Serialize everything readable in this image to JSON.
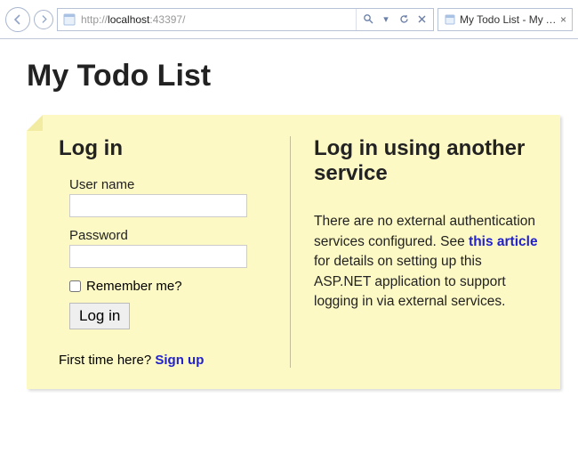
{
  "browser": {
    "url_scheme": "http://",
    "url_host": "localhost",
    "url_port": ":43397/",
    "tab_title": "My Todo List - My A..."
  },
  "page": {
    "title": "My Todo List"
  },
  "login": {
    "heading": "Log in",
    "username_label": "User name",
    "username_value": "",
    "password_label": "Password",
    "password_value": "",
    "remember_label": "Remember me?",
    "submit_label": "Log in",
    "signup_prefix": "First time here? ",
    "signup_link": "Sign up"
  },
  "external": {
    "heading": "Log in using another service",
    "text_before": "There are no external authentication services configured. See ",
    "link_text": "this article",
    "text_after": " for details on setting up this ASP.NET application to support logging in via external services."
  }
}
